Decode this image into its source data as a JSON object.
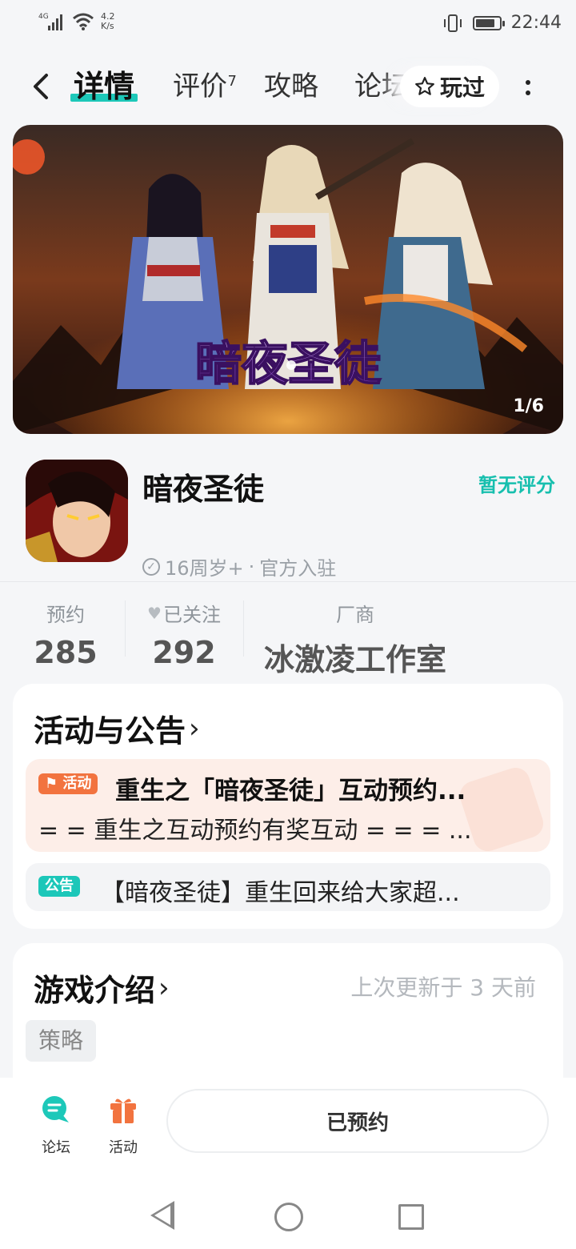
{
  "status_bar": {
    "signal": "4G",
    "net_speed_value": "4.2",
    "net_speed_unit": "K/s",
    "time": "22:44",
    "battery_level": 0.85
  },
  "nav": {
    "tabs": [
      {
        "label": "详情",
        "active": true
      },
      {
        "label": "评价",
        "badge": "7"
      },
      {
        "label": "攻略"
      },
      {
        "label": "论坛"
      }
    ],
    "played_label": "玩过"
  },
  "banner": {
    "logo_text": "暗夜圣徒",
    "counter": "1/6"
  },
  "game": {
    "title": "暗夜圣徒",
    "rating_text": "暂无评分",
    "age": "16周岁+",
    "separator": "·",
    "official": "官方入驻"
  },
  "stats": [
    {
      "label": "预约",
      "value": "285"
    },
    {
      "label": "已关注",
      "value": "292"
    },
    {
      "label": "厂商",
      "value": "冰激凌工作室"
    }
  ],
  "announcements": {
    "title": "活动与公告",
    "activity": {
      "tag": "活动",
      "title": "重生之「暗夜圣徒」互动预约...",
      "subtitle": "= = 重生之互动预约有奖互动 = = = ..."
    },
    "notice": {
      "tag": "公告",
      "text": "【暗夜圣徒】重生回来给大家超..."
    }
  },
  "intro": {
    "title": "游戏介绍",
    "update_text": "上次更新于 3 天前",
    "tag": "策略"
  },
  "bottom_bar": {
    "forum_label": "论坛",
    "activity_label": "活动",
    "reserve_label": "已预约"
  },
  "colors": {
    "accent": "#1dc8b9",
    "activity": "#f2733f",
    "background": "#f5f6f8"
  }
}
